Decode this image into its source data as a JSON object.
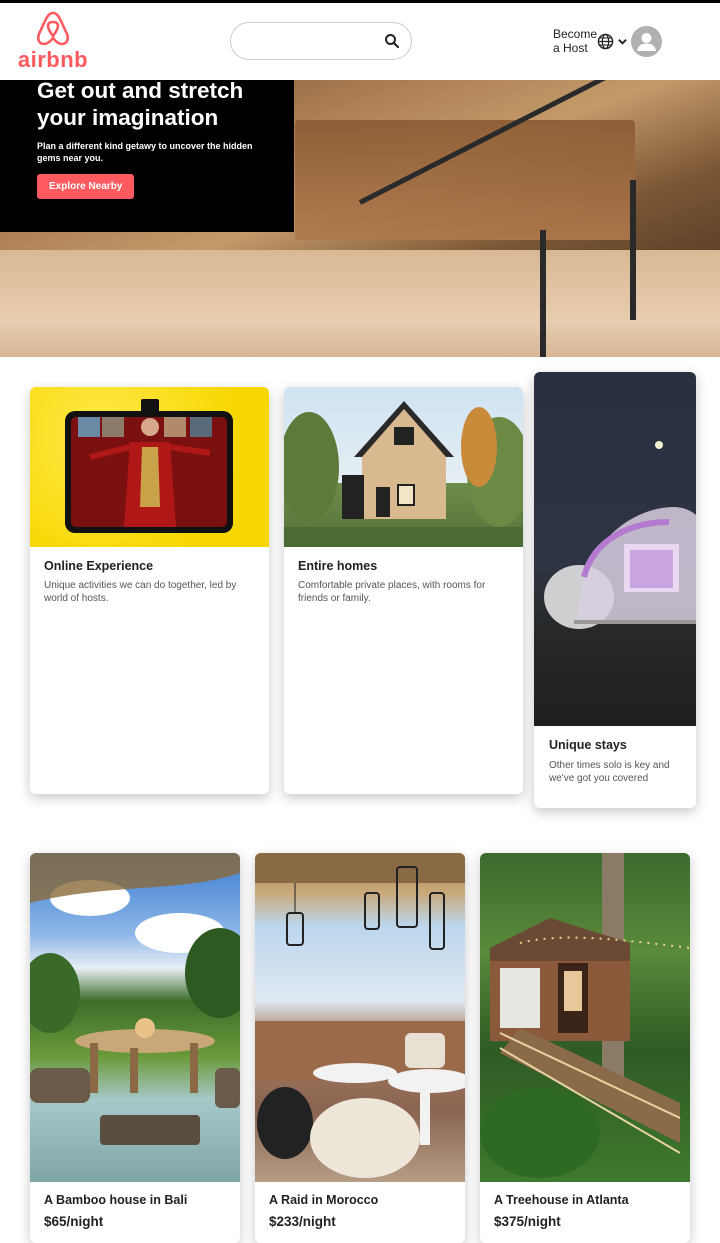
{
  "header": {
    "logo_text": "airbnb",
    "search": {
      "placeholder": "",
      "value": ""
    },
    "become_host_label": "Become a Host",
    "brand_color": "#ff5a5f"
  },
  "hero": {
    "title": "Get out and stretch your imagination",
    "subtitle": "Plan a different kind getawy to uncover the hidden gems near you.",
    "button_label": "Explore Nearby"
  },
  "categories": [
    {
      "title": "Online Experience",
      "description": "Unique activities we can do together, led by world of hosts."
    },
    {
      "title": "Entire homes",
      "description": "Comfortable private places, with rooms for friends or family."
    },
    {
      "title": "Unique stays",
      "description": "Other times solo is key and we've got you covered"
    }
  ],
  "listings": [
    {
      "title": "A Bamboo house in Bali",
      "price": "$65/night"
    },
    {
      "title": "A Raid in Morocco",
      "price": "$233/night"
    },
    {
      "title": "A Treehouse in Atlanta",
      "price": "$375/night"
    }
  ],
  "icons": [
    "airbnb-logo-icon",
    "search-icon",
    "globe-icon",
    "chevron-down-icon",
    "user-avatar-icon"
  ]
}
